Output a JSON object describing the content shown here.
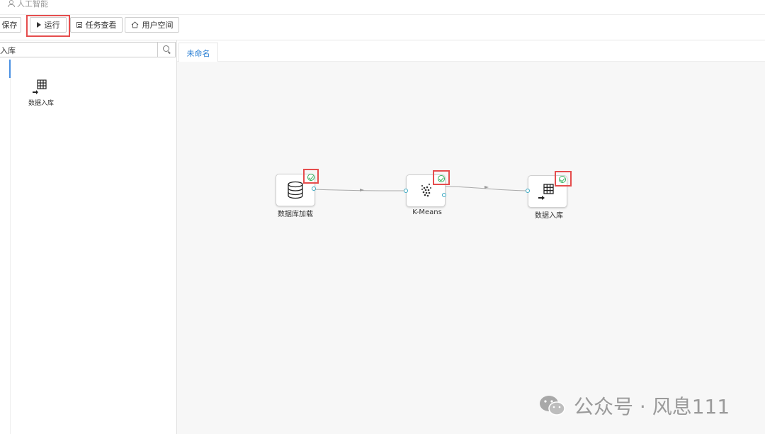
{
  "header": {
    "breadcrumb": "人工智能"
  },
  "toolbar": {
    "save_label": "保存",
    "run_label": "运行",
    "tasks_label": "任务查看",
    "space_label": "用户空间"
  },
  "sidebar": {
    "search_value": "入库",
    "results": [
      {
        "label": "数据入库",
        "icon": "table-export-icon"
      }
    ]
  },
  "editor": {
    "tabs": [
      {
        "label": "未命名",
        "active": true
      }
    ],
    "nodes": [
      {
        "label": "数据库加载",
        "icon": "database-icon",
        "status": "success"
      },
      {
        "label": "K-Means",
        "icon": "cluster-icon",
        "status": "success"
      },
      {
        "label": "数据入库",
        "icon": "table-export-icon",
        "status": "success"
      }
    ]
  },
  "watermark": {
    "text": "公众号 · 风息111"
  },
  "colors": {
    "accent": "#2a7fd4",
    "highlight": "#e54d4d",
    "success": "#2fb05a",
    "port": "#3aa8c1"
  }
}
